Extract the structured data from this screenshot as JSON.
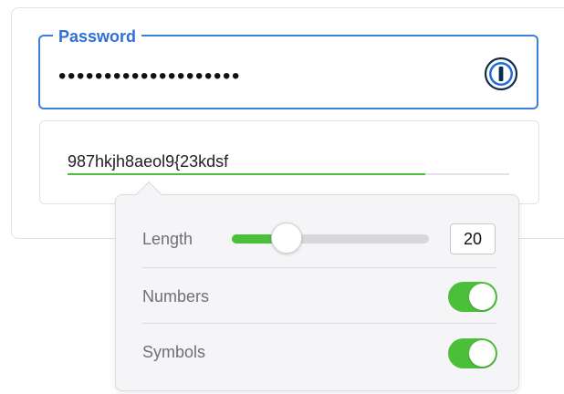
{
  "password_field": {
    "label": "Password",
    "masked_value": "••••••••••••••••••••",
    "manager_icon": "1password-keyhole-icon"
  },
  "generated": {
    "value": "987hkjh8aeol9{23kdsf",
    "strength": 0.81
  },
  "options": {
    "length": {
      "label": "Length",
      "value": "20",
      "slider_fraction": 0.28
    },
    "numbers": {
      "label": "Numbers",
      "enabled": true
    },
    "symbols": {
      "label": "Symbols",
      "enabled": true
    }
  },
  "colors": {
    "accent_blue": "#3d7ddb",
    "success_green": "#4cbf3a"
  }
}
